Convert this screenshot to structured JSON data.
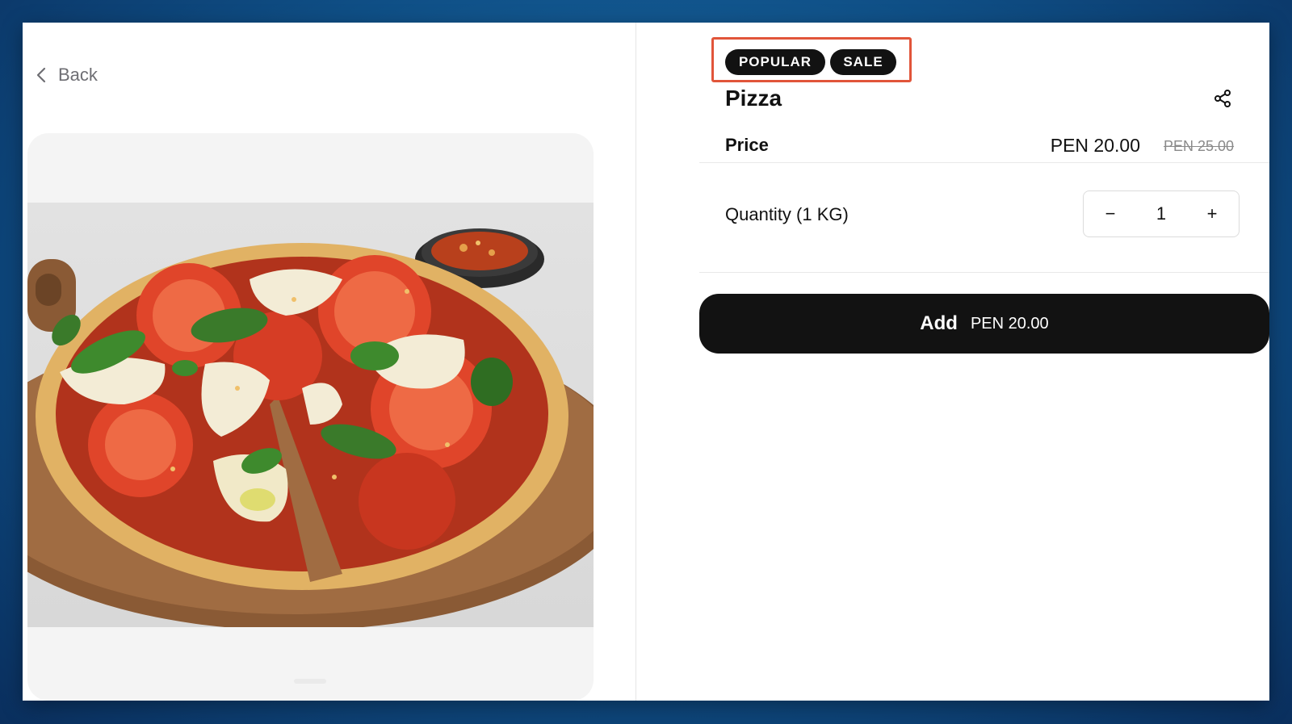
{
  "nav": {
    "back_label": "Back"
  },
  "product": {
    "badges": [
      "POPULAR",
      "SALE"
    ],
    "name": "Pizza",
    "price_label": "Price",
    "price_current": "PEN 20.00",
    "price_original": "PEN 25.00",
    "quantity_label": "Quantity (1 KG)",
    "quantity_value": "1",
    "decrement_symbol": "−",
    "increment_symbol": "+"
  },
  "cta": {
    "label": "Add",
    "amount": "PEN 20.00"
  },
  "icons": {
    "back": "chevron-left-icon",
    "share": "share-icon"
  },
  "colors": {
    "highlight_border": "#e1553a",
    "button_bg": "#121212",
    "badge_bg": "#121212"
  }
}
